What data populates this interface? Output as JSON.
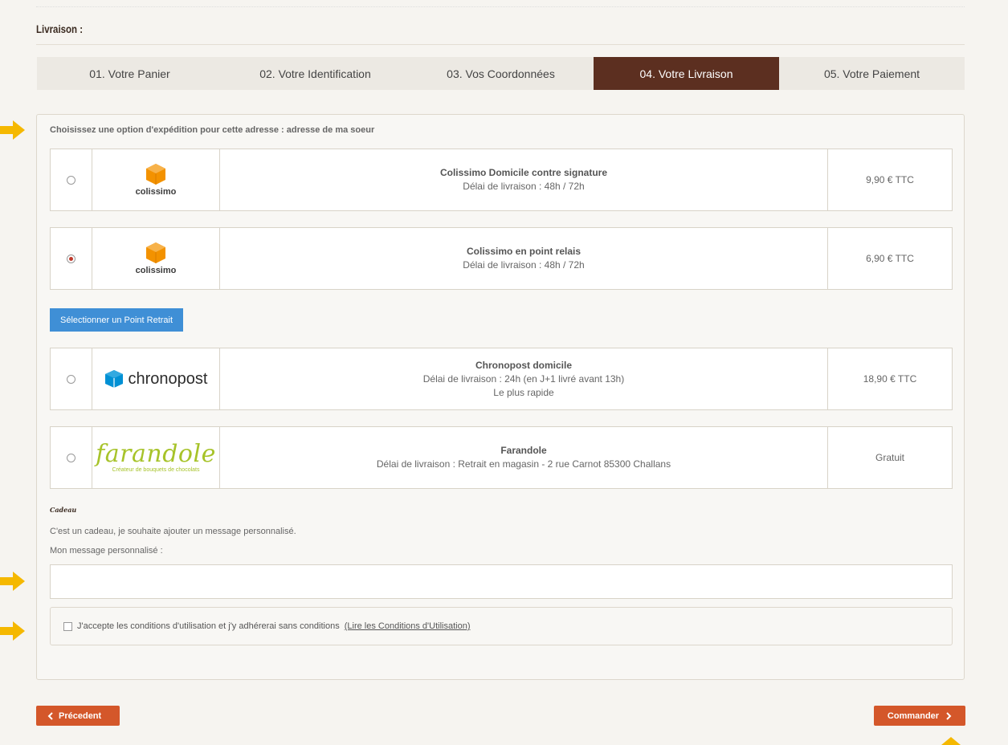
{
  "section_title": "Livraison :",
  "steps": [
    {
      "label": "01. Votre Panier",
      "active": false
    },
    {
      "label": "02. Votre Identification",
      "active": false
    },
    {
      "label": "03. Vos Coordonnées",
      "active": false
    },
    {
      "label": "04. Votre Livraison",
      "active": true
    },
    {
      "label": "05. Votre Paiement",
      "active": false
    }
  ],
  "shipping": {
    "heading": "Choisissez une option d'expédition pour cette adresse : adresse de ma soeur",
    "options": [
      {
        "logo": "colissimo",
        "name": "Colissimo Domicile contre signature",
        "delay": "Délai de livraison : 48h / 72h",
        "extra": "",
        "price": "9,90 € TTC",
        "selected": false
      },
      {
        "logo": "colissimo",
        "name": "Colissimo en point relais",
        "delay": "Délai de livraison : 48h / 72h",
        "extra": "",
        "price": "6,90 € TTC",
        "selected": true
      },
      {
        "logo": "chronopost",
        "name": "Chronopost domicile",
        "delay": "Délai de livraison : 24h (en J+1 livré avant 13h)",
        "extra": "Le plus rapide",
        "price": "18,90 € TTC",
        "selected": false
      },
      {
        "logo": "farandole",
        "name": "Farandole",
        "delay": "Délai de livraison : Retrait en magasin - 2 rue Carnot 85300 Challans",
        "extra": "",
        "price": "Gratuit",
        "selected": false
      }
    ],
    "select_point_button": "Sélectionner un Point Retrait"
  },
  "logos": {
    "colissimo_text": "colissimo",
    "chronopost_text": "chronopost",
    "farandole_text": "farandole",
    "farandole_sub": "Créateur de bouquets de chocolats"
  },
  "gift": {
    "title": "Cadeau",
    "text": "C'est un cadeau, je souhaite ajouter un message personnalisé.",
    "message_label": "Mon message personnalisé :",
    "message_value": ""
  },
  "terms": {
    "text": "J'accepte les conditions d'utilisation et j'y adhérerai sans conditions",
    "link": "(Lire les Conditions d'Utilisation)",
    "checked": false
  },
  "nav": {
    "prev_label": "Précedent",
    "next_label": "Commander"
  },
  "colors": {
    "active_step": "#5c2f20",
    "primary_button": "#3f8fd6",
    "nav_button": "#d4572a",
    "arrow": "#f5b800",
    "colissimo_orange": "#f39200",
    "chronopost_blue": "#0090d4",
    "farandole_green": "#a7c32a"
  }
}
